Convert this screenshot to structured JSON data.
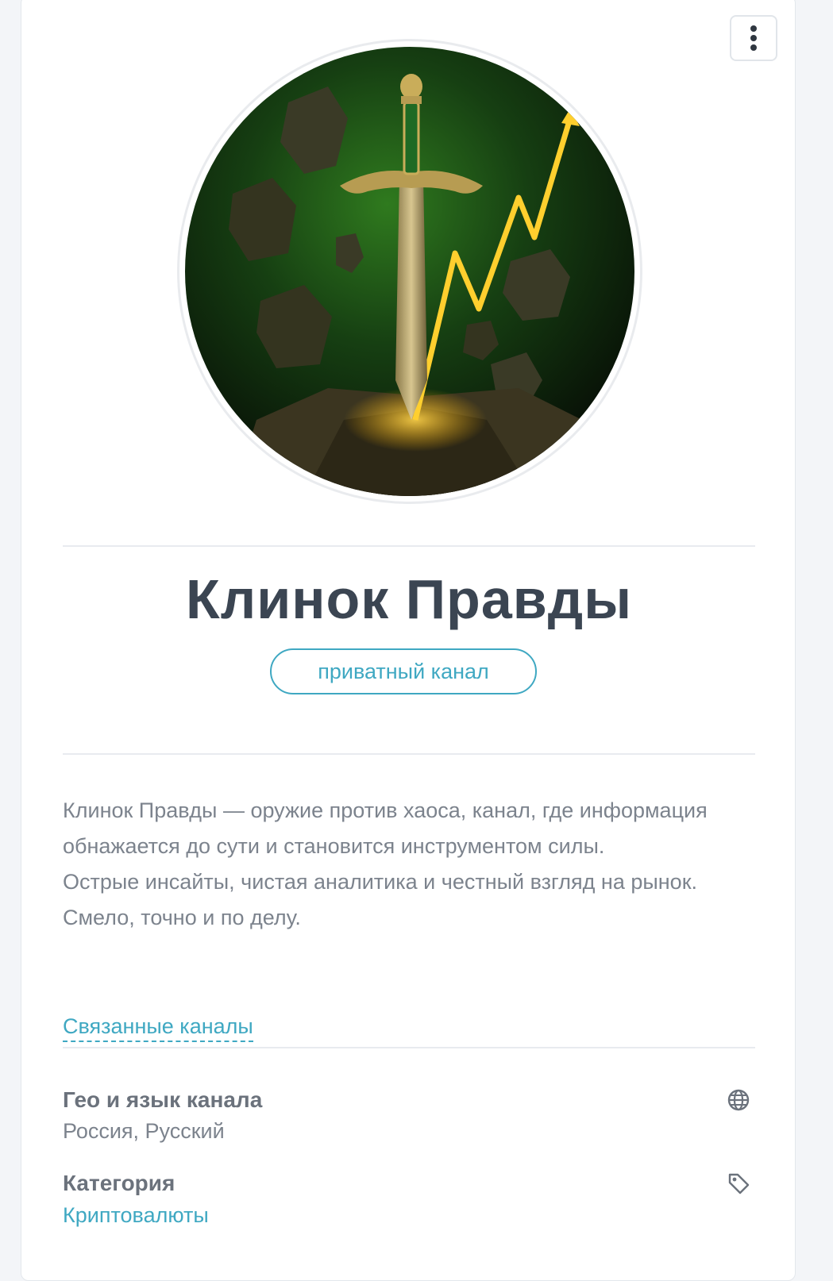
{
  "channel": {
    "name": "Клинок Правды",
    "badge": "приватный канал",
    "description_lines": [
      "Клинок Правды — оружие против хаоса, канал, где информация обнажается до сути и становится инструментом силы.",
      "Острые инсайты, чистая аналитика и честный взгляд на рынок. Смело, точно и по делу."
    ],
    "related_link": "Связанные каналы"
  },
  "info": {
    "geo": {
      "label": "Гео и язык канала",
      "value": "Россия, Русский",
      "icon": "globe-icon"
    },
    "category": {
      "label": "Категория",
      "value": "Криптовалюты",
      "icon": "tag-icon"
    }
  },
  "colors": {
    "accent": "#3fa8c2",
    "title": "#3b4552",
    "text": "#7c838d"
  }
}
